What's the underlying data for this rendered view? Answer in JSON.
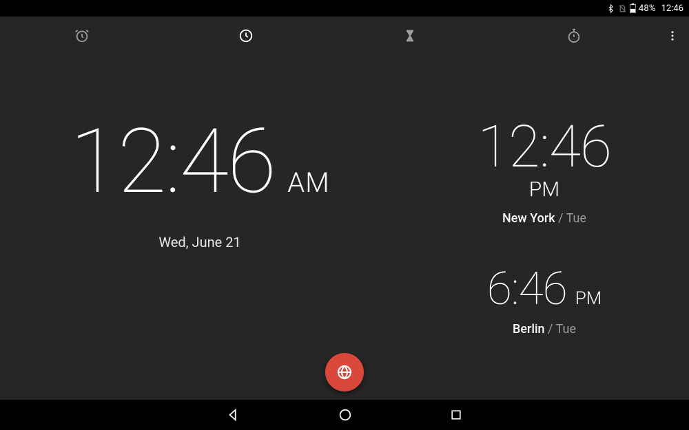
{
  "status_bar": {
    "battery_pct": "48%",
    "time": "12:46"
  },
  "tabs": {
    "alarm": {
      "name": "alarm-icon"
    },
    "clock": {
      "name": "clock-icon"
    },
    "timer": {
      "name": "hourglass-icon"
    },
    "stopwatch": {
      "name": "stopwatch-icon"
    }
  },
  "main_clock": {
    "time": "12:46",
    "ampm": "AM",
    "date": "Wed, June 21"
  },
  "world_clocks": [
    {
      "time": "12:46",
      "ampm": "PM",
      "ampm_position": "below",
      "city": "New York",
      "day": "Tue"
    },
    {
      "time": "6:46",
      "ampm": "PM",
      "ampm_position": "inline",
      "city": "Berlin",
      "day": "Tue"
    }
  ],
  "fab": {
    "accent_color": "#d9483b"
  }
}
